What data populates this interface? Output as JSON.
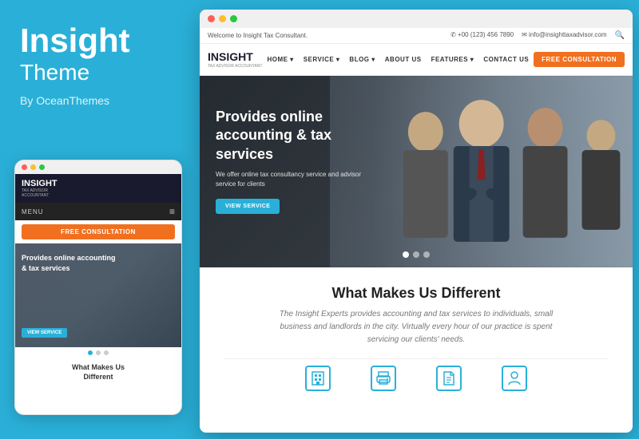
{
  "left": {
    "brand": "Insight",
    "theme_label": "Theme",
    "author": "By OceanThemes"
  },
  "mobile": {
    "dots": [
      "red",
      "yellow",
      "green"
    ],
    "logo": "INSIGHT",
    "logo_sub1": "TAX ADVISOR",
    "logo_sub2": "ACCOUNTANT",
    "menu_label": "MENU",
    "cta_button": "FREE CONSULTATION",
    "hero_title": "Provides online accounting & tax services",
    "view_service": "VIEW SERVICE",
    "bottom_title": "What Makes Us\nDifferent",
    "bottom_text": ""
  },
  "desktop": {
    "topbar": {
      "welcome": "Welcome to Insight Tax Consultant.",
      "phone": "✆ +00 (123) 456 7890",
      "email": "✉ info@insighttaxadvisor.com"
    },
    "nav": {
      "logo": "INSIGHT",
      "logo_sub1": "TAX ADVISOR",
      "logo_sub2": "ACCOUNTANT",
      "links": [
        "HOME ▾",
        "SERVICE ▾",
        "BLOG ▾",
        "ABOUT US",
        "FEATURES ▾",
        "CONTACT US"
      ],
      "cta": "FREE CONSULTATION"
    },
    "hero": {
      "title": "Provides online accounting & tax services",
      "desc": "We offer online tax consultancy service and advisor service for clients",
      "btn": "VIEW SERVICE"
    },
    "section": {
      "title": "What Makes Us Different",
      "desc": "The Insight Experts provides accounting and tax services to individuals, small business and landlords in the city. Virtually every hour of our practice is spent servicing our clients' needs.",
      "icons": [
        {
          "name": "building-icon",
          "shape": "building"
        },
        {
          "name": "printer-icon",
          "shape": "printer"
        },
        {
          "name": "document-icon",
          "shape": "document"
        },
        {
          "name": "person-icon",
          "shape": "person"
        }
      ]
    }
  }
}
